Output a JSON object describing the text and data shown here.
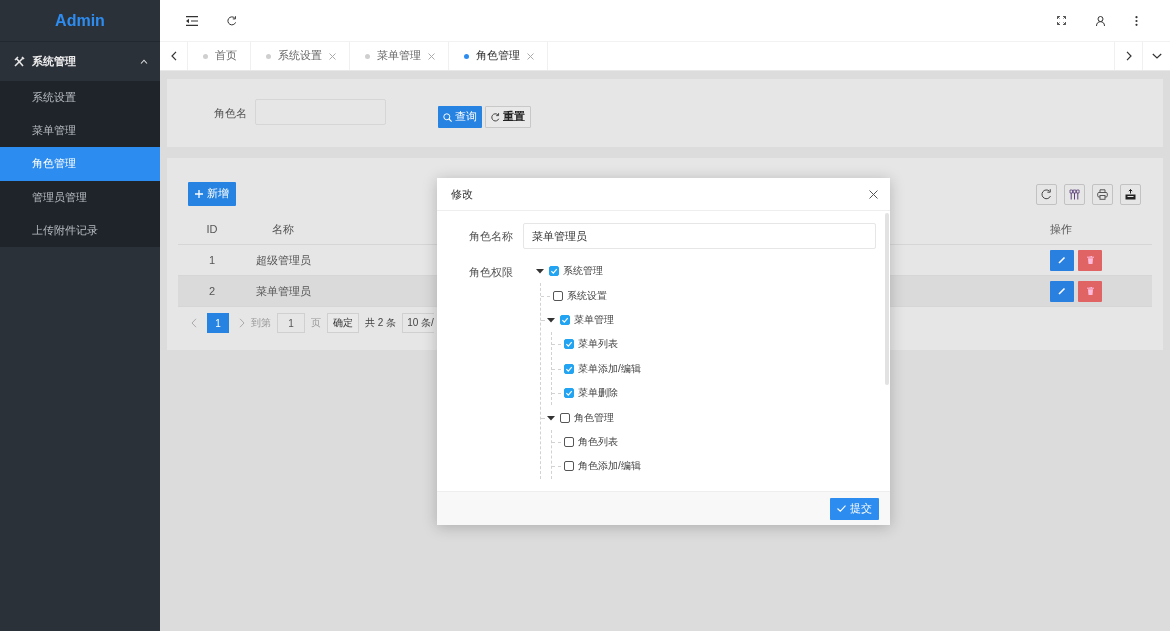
{
  "sidebar": {
    "logo": "Admin",
    "menu": [
      {
        "label": "系统管理",
        "expanded": true,
        "children": [
          {
            "label": "系统设置",
            "selected": false
          },
          {
            "label": "菜单管理",
            "selected": false
          },
          {
            "label": "角色管理",
            "selected": true
          },
          {
            "label": "管理员管理",
            "selected": false
          },
          {
            "label": "上传附件记录",
            "selected": false
          }
        ]
      }
    ]
  },
  "tabs": [
    {
      "label": "首页",
      "selected": false,
      "closable": false
    },
    {
      "label": "系统设置",
      "selected": false,
      "closable": true
    },
    {
      "label": "菜单管理",
      "selected": false,
      "closable": true
    },
    {
      "label": "角色管理",
      "selected": true,
      "closable": true
    }
  ],
  "search": {
    "label": "角色名",
    "buttons": [
      {
        "label": "查询",
        "kind": "primary"
      },
      {
        "label": "重置",
        "kind": "default"
      }
    ]
  },
  "table": {
    "add_button": "新增",
    "columns": [
      {
        "label": "ID"
      },
      {
        "label": "名称"
      },
      {
        "label": "操作"
      }
    ],
    "rows": [
      {
        "id": "1",
        "name": "超级管理员",
        "selected": false
      },
      {
        "id": "2",
        "name": "菜单管理员",
        "selected": true
      }
    ]
  },
  "pagination": {
    "pages": [
      {
        "label": "1",
        "selected": true
      }
    ],
    "goto_label": "到第",
    "goto_value": "1",
    "page_unit": "页",
    "confirm": "确定",
    "total": "共 2 条",
    "page_size": "10 条/"
  },
  "dialog": {
    "title": "修改",
    "name_label": "角色名称",
    "name_value": "菜单管理员",
    "permissions_label": "角色权限",
    "tree": [
      {
        "label": "系统管理",
        "checked": true,
        "expanded": true,
        "children": [
          {
            "label": "系统设置",
            "checked": false
          },
          {
            "label": "菜单管理",
            "checked": true,
            "expanded": true,
            "children": [
              {
                "label": "菜单列表",
                "checked": true
              },
              {
                "label": "菜单添加/编辑",
                "checked": true
              },
              {
                "label": "菜单删除",
                "checked": true
              }
            ]
          },
          {
            "label": "角色管理",
            "checked": false,
            "expanded": true,
            "children": [
              {
                "label": "角色列表",
                "checked": false
              },
              {
                "label": "角色添加/编辑",
                "checked": false
              }
            ]
          }
        ]
      }
    ],
    "submit": "提交"
  }
}
